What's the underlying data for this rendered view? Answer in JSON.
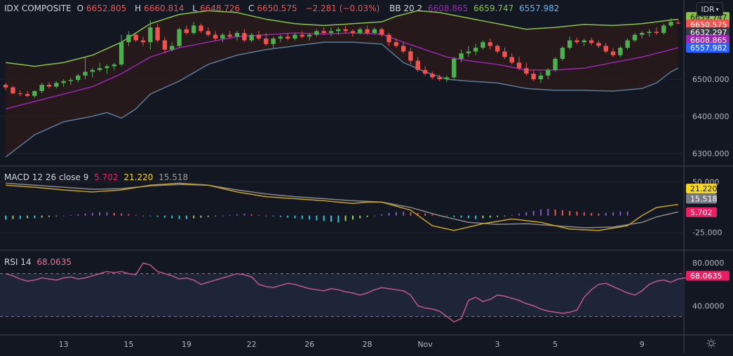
{
  "header": {
    "symbol": "IDX COMPOSITE",
    "o_label": "O",
    "o_value": "6652.805",
    "h_label": "H",
    "h_value": "6660.814",
    "l_label": "L",
    "l_value": "6648.726",
    "c_label": "C",
    "c_value": "6650.575",
    "change": "−2.281 (−0.03%)",
    "bb_label": "BB 20 2",
    "bb_mid": "6608.865",
    "bb_upper": "6659.747",
    "bb_lower": "6557.982"
  },
  "macd_legend": {
    "label": "MACD 12 26 close 9",
    "hist": "5.702",
    "macd": "21.220",
    "signal": "15.518"
  },
  "rsi_legend": {
    "label": "RSI 14",
    "value": "68.0635"
  },
  "currency": "IDR",
  "colors": {
    "background": "#131722",
    "grid": "#1e222d",
    "up": "#26a69a",
    "up_candle": "#4caf50",
    "down": "#ef5350",
    "bb_upper": "#8bc34a",
    "bb_mid": "#9c27b0",
    "bb_lower": "#5b7c99",
    "bb_fill": "#2a1a1a",
    "macd": "#c9a227",
    "signal": "#8a8a8a",
    "rsi": "#c2568f",
    "rsi_band": "#1f2538"
  },
  "chart_data": {
    "type": "candlestick",
    "x_labels": [
      "13",
      "15",
      "19",
      "22",
      "26",
      "28",
      "Nov",
      "3",
      "5",
      "9"
    ],
    "price": {
      "y_ticks": [
        "6300.000",
        "6400.000",
        "6500.000"
      ],
      "ylim": [
        6275,
        6695
      ],
      "candles": [
        [
          6485,
          6490,
          6470,
          6478
        ],
        [
          6478,
          6482,
          6460,
          6462
        ],
        [
          6462,
          6470,
          6455,
          6460
        ],
        [
          6460,
          6468,
          6452,
          6455
        ],
        [
          6455,
          6470,
          6450,
          6468
        ],
        [
          6468,
          6490,
          6462,
          6485
        ],
        [
          6485,
          6492,
          6475,
          6480
        ],
        [
          6480,
          6495,
          6475,
          6490
        ],
        [
          6490,
          6500,
          6480,
          6495
        ],
        [
          6495,
          6505,
          6485,
          6498
        ],
        [
          6498,
          6515,
          6492,
          6510
        ],
        [
          6510,
          6560,
          6500,
          6520
        ],
        [
          6520,
          6530,
          6505,
          6525
        ],
        [
          6525,
          6545,
          6520,
          6530
        ],
        [
          6530,
          6540,
          6515,
          6535
        ],
        [
          6535,
          6545,
          6525,
          6540
        ],
        [
          6540,
          6620,
          6535,
          6600
        ],
        [
          6600,
          6630,
          6590,
          6620
        ],
        [
          6620,
          6625,
          6600,
          6605
        ],
        [
          6605,
          6615,
          6590,
          6600
        ],
        [
          6600,
          6660,
          6580,
          6640
        ],
        [
          6640,
          6650,
          6600,
          6605
        ],
        [
          6605,
          6615,
          6570,
          6580
        ],
        [
          6580,
          6600,
          6575,
          6590
        ],
        [
          6590,
          6640,
          6585,
          6635
        ],
        [
          6635,
          6645,
          6620,
          6625
        ],
        [
          6625,
          6655,
          6620,
          6645
        ],
        [
          6645,
          6650,
          6625,
          6630
        ],
        [
          6630,
          6640,
          6615,
          6620
        ],
        [
          6620,
          6630,
          6605,
          6610
        ],
        [
          6610,
          6625,
          6600,
          6620
        ],
        [
          6620,
          6630,
          6610,
          6615
        ],
        [
          6615,
          6630,
          6605,
          6625
        ],
        [
          6625,
          6635,
          6600,
          6605
        ],
        [
          6605,
          6625,
          6600,
          6620
        ],
        [
          6620,
          6630,
          6605,
          6610
        ],
        [
          6610,
          6625,
          6590,
          6595
        ],
        [
          6595,
          6615,
          6585,
          6610
        ],
        [
          6610,
          6620,
          6600,
          6615
        ],
        [
          6615,
          6625,
          6605,
          6610
        ],
        [
          6610,
          6625,
          6605,
          6620
        ],
        [
          6620,
          6630,
          6610,
          6615
        ],
        [
          6615,
          6625,
          6605,
          6620
        ],
        [
          6620,
          6635,
          6615,
          6630
        ],
        [
          6630,
          6640,
          6620,
          6625
        ],
        [
          6625,
          6640,
          6615,
          6630
        ],
        [
          6630,
          6640,
          6620,
          6635
        ],
        [
          6635,
          6645,
          6625,
          6630
        ],
        [
          6630,
          6635,
          6615,
          6625
        ],
        [
          6625,
          6640,
          6620,
          6635
        ],
        [
          6635,
          6645,
          6620,
          6625
        ],
        [
          6625,
          6640,
          6620,
          6635
        ],
        [
          6635,
          6640,
          6615,
          6620
        ],
        [
          6620,
          6625,
          6590,
          6600
        ],
        [
          6600,
          6610,
          6585,
          6590
        ],
        [
          6590,
          6600,
          6570,
          6575
        ],
        [
          6575,
          6585,
          6540,
          6550
        ],
        [
          6550,
          6560,
          6520,
          6525
        ],
        [
          6525,
          6535,
          6510,
          6515
        ],
        [
          6515,
          6520,
          6500,
          6505
        ],
        [
          6505,
          6512,
          6495,
          6500
        ],
        [
          6500,
          6510,
          6492,
          6505
        ],
        [
          6505,
          6560,
          6500,
          6555
        ],
        [
          6555,
          6580,
          6545,
          6570
        ],
        [
          6570,
          6590,
          6560,
          6575
        ],
        [
          6575,
          6595,
          6565,
          6585
        ],
        [
          6585,
          6605,
          6580,
          6600
        ],
        [
          6600,
          6610,
          6580,
          6590
        ],
        [
          6590,
          6595,
          6570,
          6575
        ],
        [
          6575,
          6585,
          6555,
          6560
        ],
        [
          6560,
          6570,
          6540,
          6545
        ],
        [
          6545,
          6560,
          6525,
          6530
        ],
        [
          6530,
          6545,
          6510,
          6515
        ],
        [
          6515,
          6525,
          6495,
          6500
        ],
        [
          6500,
          6520,
          6490,
          6510
        ],
        [
          6510,
          6530,
          6500,
          6525
        ],
        [
          6525,
          6560,
          6520,
          6555
        ],
        [
          6555,
          6590,
          6550,
          6585
        ],
        [
          6585,
          6615,
          6580,
          6605
        ],
        [
          6605,
          6612,
          6595,
          6600
        ],
        [
          6600,
          6610,
          6590,
          6605
        ],
        [
          6605,
          6612,
          6592,
          6598
        ],
        [
          6598,
          6605,
          6585,
          6590
        ],
        [
          6590,
          6598,
          6570,
          6575
        ],
        [
          6575,
          6585,
          6560,
          6565
        ],
        [
          6565,
          6590,
          6560,
          6585
        ],
        [
          6585,
          6610,
          6580,
          6605
        ],
        [
          6605,
          6625,
          6600,
          6620
        ],
        [
          6620,
          6630,
          6610,
          6625
        ],
        [
          6625,
          6635,
          6615,
          6628
        ],
        [
          6628,
          6640,
          6620,
          6625
        ],
        [
          6625,
          6650,
          6620,
          6645
        ],
        [
          6645,
          6665,
          6640,
          6655
        ],
        [
          6652.805,
          6660.814,
          6648.726,
          6650.575
        ]
      ]
    },
    "bollinger": {
      "upper": [
        [
          0,
          6545
        ],
        [
          4,
          6535
        ],
        [
          8,
          6545
        ],
        [
          12,
          6565
        ],
        [
          16,
          6600
        ],
        [
          20,
          6650
        ],
        [
          24,
          6675
        ],
        [
          28,
          6685
        ],
        [
          32,
          6680
        ],
        [
          36,
          6662
        ],
        [
          40,
          6650
        ],
        [
          44,
          6645
        ],
        [
          48,
          6650
        ],
        [
          52,
          6655
        ],
        [
          54,
          6670
        ],
        [
          57,
          6685
        ],
        [
          60,
          6680
        ],
        [
          64,
          6665
        ],
        [
          68,
          6650
        ],
        [
          72,
          6635
        ],
        [
          76,
          6640
        ],
        [
          80,
          6648
        ],
        [
          84,
          6645
        ],
        [
          88,
          6650
        ],
        [
          92,
          6660
        ],
        [
          93,
          6662
        ]
      ],
      "mid": [
        [
          0,
          6420
        ],
        [
          4,
          6440
        ],
        [
          8,
          6460
        ],
        [
          12,
          6480
        ],
        [
          16,
          6515
        ],
        [
          20,
          6560
        ],
        [
          24,
          6585
        ],
        [
          28,
          6600
        ],
        [
          32,
          6615
        ],
        [
          36,
          6620
        ],
        [
          40,
          6625
        ],
        [
          44,
          6622
        ],
        [
          48,
          6625
        ],
        [
          52,
          6622
        ],
        [
          55,
          6600
        ],
        [
          58,
          6580
        ],
        [
          61,
          6560
        ],
        [
          64,
          6550
        ],
        [
          68,
          6540
        ],
        [
          72,
          6525
        ],
        [
          76,
          6525
        ],
        [
          80,
          6530
        ],
        [
          84,
          6545
        ],
        [
          88,
          6560
        ],
        [
          92,
          6580
        ],
        [
          93,
          6585
        ]
      ],
      "lower": [
        [
          0,
          6290
        ],
        [
          4,
          6350
        ],
        [
          8,
          6385
        ],
        [
          12,
          6400
        ],
        [
          14,
          6410
        ],
        [
          16,
          6395
        ],
        [
          18,
          6420
        ],
        [
          20,
          6460
        ],
        [
          24,
          6495
        ],
        [
          28,
          6540
        ],
        [
          32,
          6565
        ],
        [
          36,
          6580
        ],
        [
          40,
          6590
        ],
        [
          44,
          6600
        ],
        [
          48,
          6600
        ],
        [
          52,
          6595
        ],
        [
          55,
          6545
        ],
        [
          58,
          6520
        ],
        [
          61,
          6500
        ],
        [
          64,
          6495
        ],
        [
          68,
          6490
        ],
        [
          72,
          6475
        ],
        [
          76,
          6470
        ],
        [
          80,
          6470
        ],
        [
          84,
          6468
        ],
        [
          88,
          6475
        ],
        [
          90,
          6490
        ],
        [
          92,
          6520
        ],
        [
          93,
          6530
        ]
      ]
    },
    "macd": {
      "y_ticks": [
        "50.000",
        "-25.000"
      ],
      "ylim": [
        -45,
        65
      ],
      "macd_line": [
        [
          0,
          45
        ],
        [
          4,
          42
        ],
        [
          8,
          38
        ],
        [
          12,
          35
        ],
        [
          16,
          38
        ],
        [
          20,
          45
        ],
        [
          24,
          48
        ],
        [
          28,
          45
        ],
        [
          32,
          35
        ],
        [
          36,
          28
        ],
        [
          40,
          25
        ],
        [
          44,
          22
        ],
        [
          48,
          18
        ],
        [
          50,
          20
        ],
        [
          52,
          20
        ],
        [
          56,
          8
        ],
        [
          59,
          -15
        ],
        [
          62,
          -22
        ],
        [
          66,
          -12
        ],
        [
          70,
          -5
        ],
        [
          74,
          -10
        ],
        [
          78,
          -20
        ],
        [
          82,
          -22
        ],
        [
          86,
          -15
        ],
        [
          88,
          0
        ],
        [
          90,
          12
        ],
        [
          94,
          18
        ],
        [
          98,
          22
        ],
        [
          101,
          25
        ]
      ],
      "signal_line": [
        [
          0,
          48
        ],
        [
          4,
          45
        ],
        [
          8,
          42
        ],
        [
          12,
          39
        ],
        [
          16,
          40
        ],
        [
          20,
          44
        ],
        [
          24,
          46
        ],
        [
          28,
          45
        ],
        [
          32,
          38
        ],
        [
          36,
          32
        ],
        [
          40,
          28
        ],
        [
          44,
          25
        ],
        [
          48,
          22
        ],
        [
          52,
          20
        ],
        [
          56,
          12
        ],
        [
          60,
          0
        ],
        [
          64,
          -10
        ],
        [
          68,
          -13
        ],
        [
          72,
          -12
        ],
        [
          76,
          -15
        ],
        [
          80,
          -18
        ],
        [
          84,
          -17
        ],
        [
          88,
          -10
        ],
        [
          90,
          -2
        ],
        [
          94,
          8
        ],
        [
          98,
          14
        ],
        [
          101,
          16
        ]
      ],
      "histogram": [
        -6,
        -5,
        -5,
        -4,
        -4,
        -3,
        -2,
        -1,
        0,
        1,
        2,
        3,
        4,
        5,
        5,
        4,
        3,
        2,
        1,
        0,
        -1,
        -2,
        -3,
        -4,
        -5,
        -5,
        -4,
        -3,
        -2,
        -1,
        0,
        1,
        2,
        3,
        2,
        1,
        0,
        -1,
        -2,
        -3,
        -4,
        -5,
        -6,
        -7,
        -8,
        -9,
        -10,
        -8,
        -6,
        -4,
        -2,
        0,
        2,
        4,
        5,
        6,
        5,
        4,
        3,
        2,
        1,
        -1,
        -2,
        -3,
        -4,
        -5,
        -4,
        -3,
        -2,
        -1,
        1,
        3,
        5,
        7,
        9,
        10,
        9,
        8,
        7,
        6,
        5,
        4,
        3,
        4,
        5,
        6,
        6
      ]
    },
    "rsi": {
      "y_ticks": [
        "80.0000",
        "40.0000"
      ],
      "ylim": [
        18,
        88
      ],
      "upper_band": 70,
      "lower_band": 30,
      "values": [
        70,
        68,
        65,
        63,
        64,
        66,
        65,
        64,
        66,
        67,
        65,
        66,
        68,
        70,
        72,
        71,
        72,
        70,
        69,
        80,
        78,
        72,
        70,
        68,
        65,
        66,
        64,
        60,
        62,
        64,
        66,
        68,
        70,
        69,
        67,
        60,
        58,
        57,
        59,
        61,
        60,
        58,
        56,
        55,
        54,
        56,
        55,
        53,
        52,
        50,
        52,
        55,
        57,
        56,
        55,
        54,
        50,
        40,
        38,
        37,
        35,
        30,
        25,
        28,
        45,
        48,
        44,
        46,
        50,
        49,
        47,
        45,
        42,
        40,
        37,
        35,
        34,
        33,
        34,
        36,
        48,
        55,
        60,
        61,
        58,
        55,
        52,
        50,
        54,
        60,
        63,
        64,
        62,
        65,
        66,
        68,
        68
      ]
    }
  }
}
